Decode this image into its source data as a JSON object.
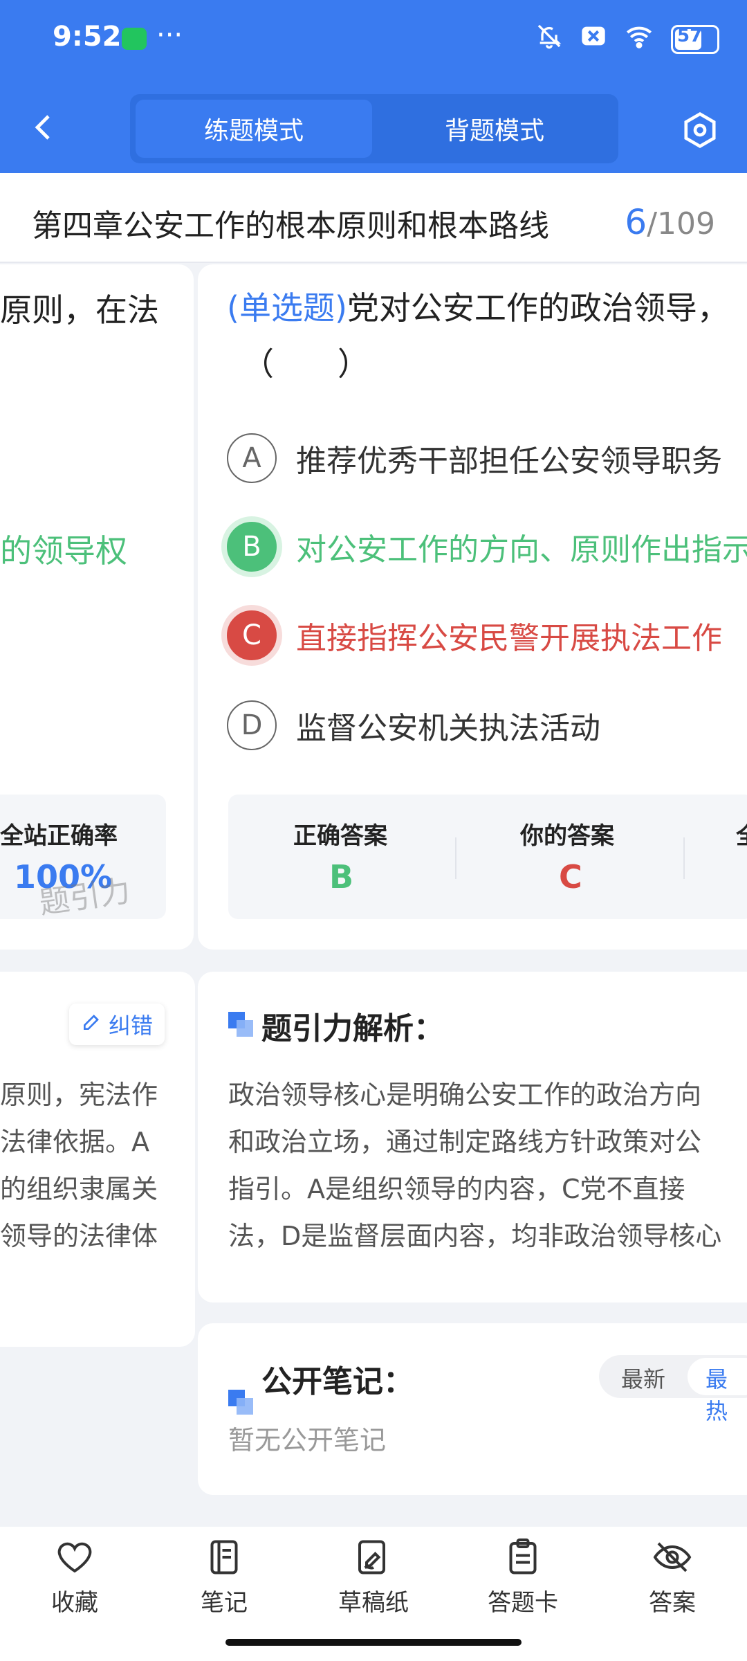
{
  "status_bar": {
    "time": "9:52",
    "battery": "57"
  },
  "header": {
    "modes": [
      {
        "label": "练题模式",
        "active": true
      },
      {
        "label": "背题模式",
        "active": false
      }
    ]
  },
  "chapter": {
    "title": "第四章公安工作的根本原则和根本路线",
    "current": "6",
    "total": "/109"
  },
  "left_card": {
    "fragments": [
      "原则，在法",
      "的领导权"
    ],
    "stat_label": "全站正确率",
    "stat_value": "100%",
    "watermark": "题引力",
    "correct_btn": "纠错",
    "analysis_lines": [
      "原则，宪法作",
      "法律依据。A",
      "的组织隶属关",
      "领导的法律体"
    ]
  },
  "question": {
    "type": "(单选题)",
    "text": "党对公安工作的政治领导，",
    "paren": "（　　）",
    "options": [
      {
        "letter": "A",
        "text": "推荐优秀干部担任公安领导职务",
        "state": "normal"
      },
      {
        "letter": "B",
        "text": "对公安工作的方向、原则作出指示",
        "state": "correct"
      },
      {
        "letter": "C",
        "text": "直接指挥公安民警开展执法工作",
        "state": "wrong"
      },
      {
        "letter": "D",
        "text": "监督公安机关执法活动",
        "state": "normal"
      }
    ]
  },
  "answer_stats": {
    "correct_label": "正确答案",
    "correct_value": "B",
    "yours_label": "你的答案",
    "yours_value": "C",
    "third_label_partial": "全"
  },
  "analysis": {
    "title": "题引力解析：",
    "lines": [
      "政治领导核心是明确公安工作的政治方向",
      "和政治立场，通过制定路线方针政策对公",
      "指引。A是组织领导的内容，C党不直接",
      "法，D是监督层面内容，均非政治领导核心"
    ]
  },
  "notes": {
    "title": "公开笔记：",
    "sort_options": [
      "最新",
      "最热"
    ],
    "empty_text": "暂无公开笔记"
  },
  "bottom_nav": [
    {
      "label": "收藏",
      "icon": "heart-icon"
    },
    {
      "label": "笔记",
      "icon": "notebook-icon"
    },
    {
      "label": "草稿纸",
      "icon": "draft-icon"
    },
    {
      "label": "答题卡",
      "icon": "answer-sheet-icon"
    },
    {
      "label": "答案",
      "icon": "eye-off-icon"
    }
  ],
  "colors": {
    "primary": "#3a7bf0",
    "correct": "#4cc07a",
    "wrong": "#d84a44"
  }
}
